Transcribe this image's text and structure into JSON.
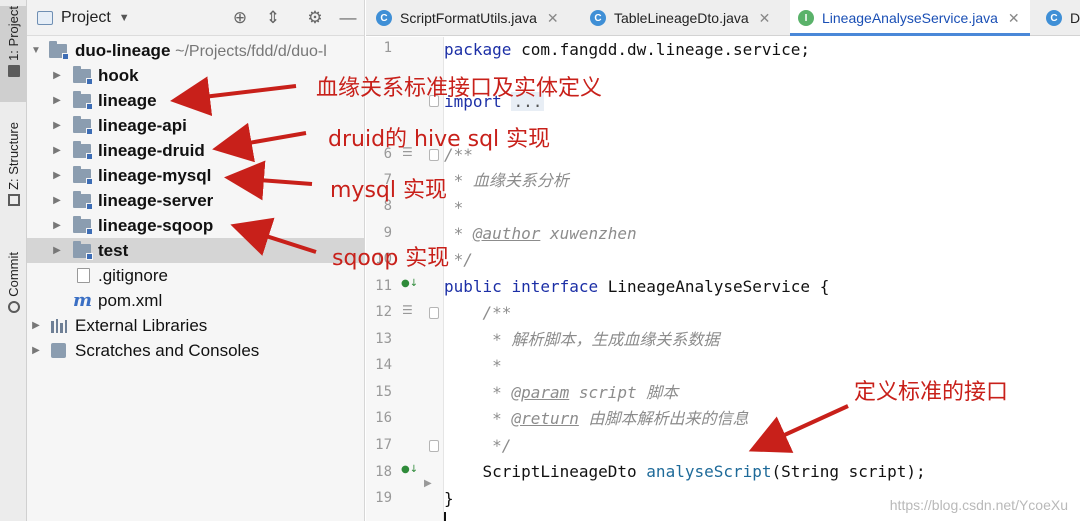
{
  "toolstrip": {
    "tabs": [
      {
        "label": "1: Project",
        "icon": "folder-icon"
      },
      {
        "label": "Z: Structure",
        "icon": "structure-icon"
      },
      {
        "label": "Commit",
        "icon": "commit-icon"
      }
    ]
  },
  "project_panel": {
    "title": "Project",
    "buttons": [
      "crosshair-icon",
      "collapse-icon",
      "gear-icon",
      "minimize-icon"
    ],
    "tree": [
      {
        "label": "duo-lineage",
        "hint": "~/Projects/fdd/d/duo-l"
      },
      {
        "label": "hook"
      },
      {
        "label": "lineage"
      },
      {
        "label": "lineage-api"
      },
      {
        "label": "lineage-druid"
      },
      {
        "label": "lineage-mysql"
      },
      {
        "label": "lineage-server"
      },
      {
        "label": "lineage-sqoop"
      },
      {
        "label": "test"
      },
      {
        "label": ".gitignore"
      },
      {
        "label": "pom.xml"
      },
      {
        "label": "External Libraries"
      },
      {
        "label": "Scratches and Consoles"
      }
    ]
  },
  "editor": {
    "tabs": [
      {
        "label": "ScriptFormatUtils.java"
      },
      {
        "label": "TableLineageDto.java"
      },
      {
        "label": "LineageAnalyseService.java",
        "active": true
      },
      {
        "label": "D"
      }
    ],
    "line_numbers": [
      "1",
      "",
      "",
      "6",
      "7",
      "8",
      "9",
      "10",
      "11",
      "12",
      "13",
      "14",
      "15",
      "16",
      "17",
      "18",
      "19",
      ""
    ],
    "code": {
      "l1_kw": "package",
      "l1_rest": " com.fangdd.dw.lineage.service;",
      "l3_kw": "import",
      "l3_dots": "...",
      "l6": "/**",
      "l7": " * 血缘关系分析",
      "l8": " *",
      "l9_pre": " * ",
      "l9_tag": "@author",
      "l9_rest": " xuwenzhen",
      "l10": " */",
      "l11_kw1": "public",
      "l11_kw2": "interface",
      "l11_rest": " LineageAnalyseService {",
      "l12": "    /**",
      "l13": "     * 解析脚本，生成血缘关系数据",
      "l14": "     *",
      "l15_pre": "     * ",
      "l15_tag": "@param",
      "l15_rest": " script 脚本",
      "l16_pre": "     * ",
      "l16_tag": "@return",
      "l16_rest": " 由脚本解析出来的信息",
      "l17": "     */",
      "l18_pre": "    ScriptLineageDto ",
      "l18_fn": "analyseScript",
      "l18_rest": "(String script);",
      "l19": "}"
    }
  },
  "annotations": {
    "lineage": "血缘关系标准接口及实体定义",
    "druid": "druid的 hive sql 实现",
    "mysql": "mysql 实现",
    "sqoop": "sqoop 实现",
    "interface": "定义标准的接口",
    "color": "#c8201a"
  },
  "watermark": "https://blog.csdn.net/YcoeXu"
}
